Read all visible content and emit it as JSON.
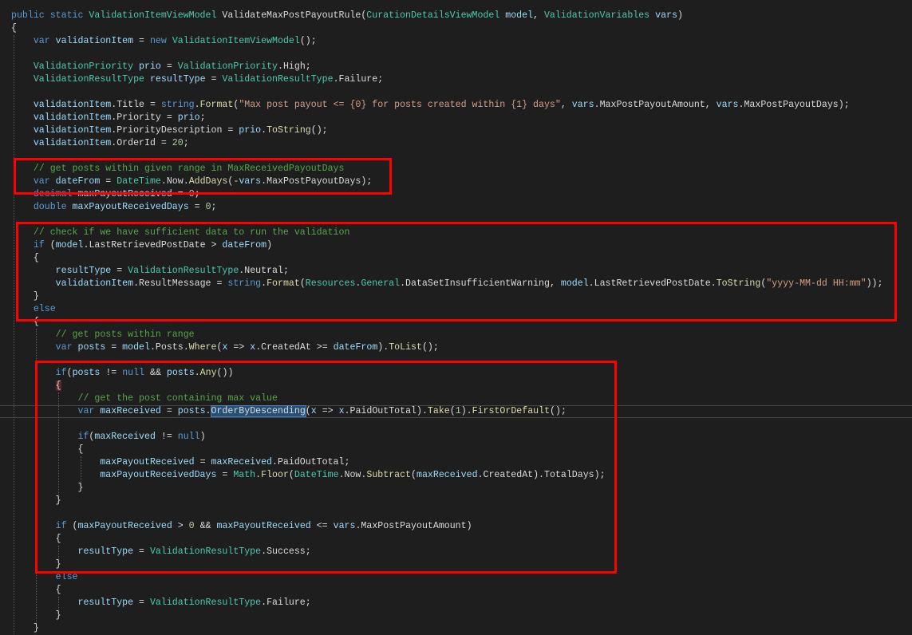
{
  "editor": {
    "colors": {
      "background": "#1e1e1e",
      "keyword": "#569cd6",
      "type": "#4ec9b0",
      "comment": "#57a64a",
      "string": "#d69d85",
      "highlight_box": "#ff0000"
    },
    "lines": [
      [
        [
          "k",
          "public static "
        ],
        [
          "t",
          "ValidationItemViewModel"
        ],
        [
          "p",
          " ValidateMaxPostPayoutRule("
        ],
        [
          "t",
          "CurationDetailsViewModel"
        ],
        [
          "v",
          " model"
        ],
        [
          "p",
          ", "
        ],
        [
          "t",
          "ValidationVariables"
        ],
        [
          "v",
          " vars"
        ],
        [
          "p",
          ")"
        ]
      ],
      [
        [
          "p",
          "{"
        ]
      ],
      [
        [
          "p",
          "    "
        ],
        [
          "k",
          "var"
        ],
        [
          "v",
          " validationItem"
        ],
        [
          "p",
          " = "
        ],
        [
          "k",
          "new "
        ],
        [
          "t",
          "ValidationItemViewModel"
        ],
        [
          "p",
          "();"
        ]
      ],
      [],
      [
        [
          "p",
          "    "
        ],
        [
          "t",
          "ValidationPriority"
        ],
        [
          "v",
          " prio"
        ],
        [
          "p",
          " = "
        ],
        [
          "t",
          "ValidationPriority"
        ],
        [
          "p",
          ".High;"
        ]
      ],
      [
        [
          "p",
          "    "
        ],
        [
          "t",
          "ValidationResultType"
        ],
        [
          "v",
          " resultType"
        ],
        [
          "p",
          " = "
        ],
        [
          "t",
          "ValidationResultType"
        ],
        [
          "p",
          ".Failure;"
        ]
      ],
      [],
      [
        [
          "p",
          "    "
        ],
        [
          "v",
          "validationItem"
        ],
        [
          "p",
          ".Title = "
        ],
        [
          "k",
          "string"
        ],
        [
          "p",
          "."
        ],
        [
          "m",
          "Format"
        ],
        [
          "p",
          "("
        ],
        [
          "s",
          "\"Max post payout <= {0} for posts created within {1} days\""
        ],
        [
          "p",
          ", "
        ],
        [
          "v",
          "vars"
        ],
        [
          "p",
          ".MaxPostPayoutAmount, "
        ],
        [
          "v",
          "vars"
        ],
        [
          "p",
          ".MaxPostPayoutDays);"
        ]
      ],
      [
        [
          "p",
          "    "
        ],
        [
          "v",
          "validationItem"
        ],
        [
          "p",
          ".Priority = "
        ],
        [
          "v",
          "prio"
        ],
        [
          "p",
          ";"
        ]
      ],
      [
        [
          "p",
          "    "
        ],
        [
          "v",
          "validationItem"
        ],
        [
          "p",
          ".PriorityDescription = "
        ],
        [
          "v",
          "prio"
        ],
        [
          "p",
          "."
        ],
        [
          "m",
          "ToString"
        ],
        [
          "p",
          "();"
        ]
      ],
      [
        [
          "p",
          "    "
        ],
        [
          "v",
          "validationItem"
        ],
        [
          "p",
          ".OrderId = "
        ],
        [
          "n",
          "20"
        ],
        [
          "p",
          ";"
        ]
      ],
      [],
      [
        [
          "p",
          "    "
        ],
        [
          "c",
          "// get posts within given range in MaxReceivedPayoutDays"
        ]
      ],
      [
        [
          "p",
          "    "
        ],
        [
          "k",
          "var"
        ],
        [
          "v",
          " dateFrom"
        ],
        [
          "p",
          " = "
        ],
        [
          "t",
          "DateTime"
        ],
        [
          "p",
          ".Now."
        ],
        [
          "m",
          "AddDays"
        ],
        [
          "p",
          "(-"
        ],
        [
          "v",
          "vars"
        ],
        [
          "p",
          ".MaxPostPayoutDays);"
        ]
      ],
      [
        [
          "p",
          "    "
        ],
        [
          "k",
          "decimal"
        ],
        [
          "v",
          " maxPayoutReceived"
        ],
        [
          "p",
          " = "
        ],
        [
          "n",
          "0"
        ],
        [
          "p",
          ";"
        ]
      ],
      [
        [
          "p",
          "    "
        ],
        [
          "k",
          "double"
        ],
        [
          "v",
          " maxPayoutReceivedDays"
        ],
        [
          "p",
          " = "
        ],
        [
          "n",
          "0"
        ],
        [
          "p",
          ";"
        ]
      ],
      [],
      [
        [
          "p",
          "    "
        ],
        [
          "c",
          "// check if we have sufficient data to run the validation"
        ]
      ],
      [
        [
          "p",
          "    "
        ],
        [
          "k",
          "if"
        ],
        [
          "p",
          " ("
        ],
        [
          "v",
          "model"
        ],
        [
          "p",
          ".LastRetrievedPostDate > "
        ],
        [
          "v",
          "dateFrom"
        ],
        [
          "p",
          ")"
        ]
      ],
      [
        [
          "p",
          "    {"
        ]
      ],
      [
        [
          "p",
          "        "
        ],
        [
          "v",
          "resultType"
        ],
        [
          "p",
          " = "
        ],
        [
          "t",
          "ValidationResultType"
        ],
        [
          "p",
          ".Neutral;"
        ]
      ],
      [
        [
          "p",
          "        "
        ],
        [
          "v",
          "validationItem"
        ],
        [
          "p",
          ".ResultMessage = "
        ],
        [
          "k",
          "string"
        ],
        [
          "p",
          "."
        ],
        [
          "m",
          "Format"
        ],
        [
          "p",
          "("
        ],
        [
          "t",
          "Resources"
        ],
        [
          "p",
          "."
        ],
        [
          "t",
          "General"
        ],
        [
          "p",
          ".DataSetInsufficientWarning, "
        ],
        [
          "v",
          "model"
        ],
        [
          "p",
          ".LastRetrievedPostDate."
        ],
        [
          "m",
          "ToString"
        ],
        [
          "p",
          "("
        ],
        [
          "s",
          "\"yyyy-MM-dd HH:mm\""
        ],
        [
          "p",
          "));"
        ]
      ],
      [
        [
          "p",
          "    }"
        ]
      ],
      [
        [
          "p",
          "    "
        ],
        [
          "k",
          "else"
        ]
      ],
      [
        [
          "p",
          "    {"
        ]
      ],
      [
        [
          "p",
          "        "
        ],
        [
          "c",
          "// get posts within range"
        ]
      ],
      [
        [
          "p",
          "        "
        ],
        [
          "k",
          "var"
        ],
        [
          "v",
          " posts"
        ],
        [
          "p",
          " = "
        ],
        [
          "v",
          "model"
        ],
        [
          "p",
          ".Posts."
        ],
        [
          "m",
          "Where"
        ],
        [
          "p",
          "("
        ],
        [
          "v",
          "x"
        ],
        [
          "p",
          " => "
        ],
        [
          "v",
          "x"
        ],
        [
          "p",
          ".CreatedAt >= "
        ],
        [
          "v",
          "dateFrom"
        ],
        [
          "p",
          ")."
        ],
        [
          "m",
          "ToList"
        ],
        [
          "p",
          "();"
        ]
      ],
      [],
      [
        [
          "p",
          "        "
        ],
        [
          "k",
          "if"
        ],
        [
          "p",
          "("
        ],
        [
          "v",
          "posts"
        ],
        [
          "p",
          " != "
        ],
        [
          "k",
          "null"
        ],
        [
          "p",
          " && "
        ],
        [
          "v",
          "posts"
        ],
        [
          "p",
          "."
        ],
        [
          "m",
          "Any"
        ],
        [
          "p",
          "())"
        ]
      ],
      [
        [
          "p",
          "        "
        ],
        [
          "br",
          "{"
        ]
      ],
      [
        [
          "p",
          "            "
        ],
        [
          "c",
          "// get the post containing max value"
        ]
      ],
      [
        [
          "p",
          "            "
        ],
        [
          "k",
          "var"
        ],
        [
          "v",
          " maxReceived"
        ],
        [
          "p",
          " = "
        ],
        [
          "v",
          "posts"
        ],
        [
          "p",
          "."
        ],
        [
          "sel",
          "OrderByDescending"
        ],
        [
          "p",
          "("
        ],
        [
          "v",
          "x"
        ],
        [
          "p",
          " => "
        ],
        [
          "v",
          "x"
        ],
        [
          "p",
          ".PaidOutTotal)."
        ],
        [
          "m",
          "Take"
        ],
        [
          "p",
          "("
        ],
        [
          "n",
          "1"
        ],
        [
          "p",
          ")."
        ],
        [
          "m",
          "FirstOrDefault"
        ],
        [
          "p",
          "();"
        ]
      ],
      [],
      [
        [
          "p",
          "            "
        ],
        [
          "k",
          "if"
        ],
        [
          "p",
          "("
        ],
        [
          "v",
          "maxReceived"
        ],
        [
          "p",
          " != "
        ],
        [
          "k",
          "null"
        ],
        [
          "p",
          ")"
        ]
      ],
      [
        [
          "p",
          "            {"
        ]
      ],
      [
        [
          "p",
          "                "
        ],
        [
          "v",
          "maxPayoutReceived"
        ],
        [
          "p",
          " = "
        ],
        [
          "v",
          "maxReceived"
        ],
        [
          "p",
          ".PaidOutTotal;"
        ]
      ],
      [
        [
          "p",
          "                "
        ],
        [
          "v",
          "maxPayoutReceivedDays"
        ],
        [
          "p",
          " = "
        ],
        [
          "t",
          "Math"
        ],
        [
          "p",
          "."
        ],
        [
          "m",
          "Floor"
        ],
        [
          "p",
          "("
        ],
        [
          "t",
          "DateTime"
        ],
        [
          "p",
          ".Now."
        ],
        [
          "m",
          "Subtract"
        ],
        [
          "p",
          "("
        ],
        [
          "v",
          "maxReceived"
        ],
        [
          "p",
          ".CreatedAt).TotalDays);"
        ]
      ],
      [
        [
          "p",
          "            }"
        ]
      ],
      [
        [
          "p",
          "        }"
        ]
      ],
      [],
      [
        [
          "p",
          "        "
        ],
        [
          "k",
          "if"
        ],
        [
          "p",
          " ("
        ],
        [
          "v",
          "maxPayoutReceived"
        ],
        [
          "p",
          " > "
        ],
        [
          "n",
          "0"
        ],
        [
          "p",
          " && "
        ],
        [
          "v",
          "maxPayoutReceived"
        ],
        [
          "p",
          " <= "
        ],
        [
          "v",
          "vars"
        ],
        [
          "p",
          ".MaxPostPayoutAmount)"
        ]
      ],
      [
        [
          "p",
          "        {"
        ]
      ],
      [
        [
          "p",
          "            "
        ],
        [
          "v",
          "resultType"
        ],
        [
          "p",
          " = "
        ],
        [
          "t",
          "ValidationResultType"
        ],
        [
          "p",
          ".Success;"
        ]
      ],
      [
        [
          "p",
          "        }"
        ]
      ],
      [
        [
          "p",
          "        "
        ],
        [
          "k",
          "else"
        ]
      ],
      [
        [
          "p",
          "        {"
        ]
      ],
      [
        [
          "p",
          "            "
        ],
        [
          "v",
          "resultType"
        ],
        [
          "p",
          " = "
        ],
        [
          "t",
          "ValidationResultType"
        ],
        [
          "p",
          ".Failure;"
        ]
      ],
      [
        [
          "p",
          "        }"
        ]
      ],
      [
        [
          "p",
          "    }"
        ]
      ]
    ]
  }
}
